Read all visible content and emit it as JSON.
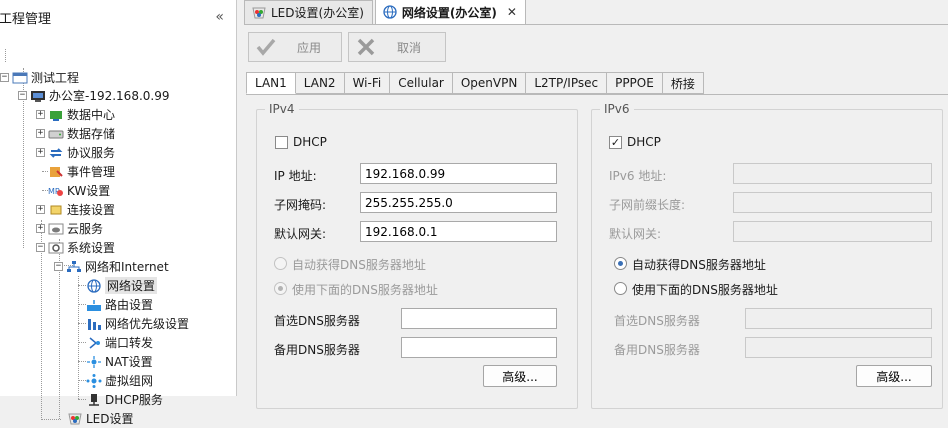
{
  "sidebar": {
    "title": "工程管理",
    "collapse_glyph": "«",
    "tree": [
      {
        "label": "测试工程",
        "expander": "−",
        "icon": "project-icon"
      },
      {
        "label": "办公室-192.168.0.99",
        "expander": "−",
        "icon": "device-icon"
      },
      {
        "label": "数据中心",
        "expander": "+",
        "icon": "data-center-icon"
      },
      {
        "label": "数据存储",
        "expander": "+",
        "icon": "storage-icon"
      },
      {
        "label": "协议服务",
        "expander": "+",
        "icon": "protocol-icon"
      },
      {
        "label": "事件管理",
        "expander": "",
        "icon": "event-icon"
      },
      {
        "label": "KW设置",
        "expander": "",
        "icon": "kw-icon"
      },
      {
        "label": "连接设置",
        "expander": "+",
        "icon": "connection-icon"
      },
      {
        "label": "云服务",
        "expander": "+",
        "icon": "cloud-icon"
      },
      {
        "label": "系统设置",
        "expander": "−",
        "icon": "system-icon"
      },
      {
        "label": "网络和Internet",
        "expander": "−",
        "icon": "network-tree-icon"
      },
      {
        "label": "网络设置",
        "expander": "",
        "icon": "globe-icon"
      },
      {
        "label": "路由设置",
        "expander": "",
        "icon": "router-icon"
      },
      {
        "label": "网络优先级设置",
        "expander": "",
        "icon": "priority-icon"
      },
      {
        "label": "端口转发",
        "expander": "",
        "icon": "port-forward-icon"
      },
      {
        "label": "NAT设置",
        "expander": "",
        "icon": "nat-icon"
      },
      {
        "label": "虚拟组网",
        "expander": "",
        "icon": "vpn-icon"
      },
      {
        "label": "DHCP服务",
        "expander": "",
        "icon": "dhcp-icon"
      },
      {
        "label": "LED设置",
        "expander": "",
        "icon": "led-icon"
      }
    ]
  },
  "doc_tabs": [
    {
      "label": "LED设置(办公室)",
      "icon": "led-icon"
    },
    {
      "label": "网络设置(办公室)",
      "icon": "globe-icon",
      "close": "✕"
    }
  ],
  "toolbar": {
    "apply_label": "应用",
    "cancel_label": "取消"
  },
  "sub_tabs": [
    "LAN1",
    "LAN2",
    "Wi-Fi",
    "Cellular",
    "OpenVPN",
    "L2TP/IPsec",
    "PPPOE",
    "桥接"
  ],
  "ipv4": {
    "legend": "IPv4",
    "dhcp_label": "DHCP",
    "dhcp_checked": false,
    "ip_label": "IP 地址:",
    "ip_value": "192.168.0.99",
    "mask_label": "子网掩码:",
    "mask_value": "255.255.255.0",
    "gateway_label": "默认网关:",
    "gateway_value": "192.168.0.1",
    "auto_dns_label": "自动获得DNS服务器地址",
    "manual_dns_label": "使用下面的DNS服务器地址",
    "preferred_dns_label": "首选DNS服务器",
    "preferred_dns_value": "",
    "alternate_dns_label": "备用DNS服务器",
    "alternate_dns_value": "",
    "advanced_label": "高级..."
  },
  "ipv6": {
    "legend": "IPv6",
    "dhcp_label": "DHCP",
    "dhcp_checked": true,
    "ip_label": "IPv6 地址:",
    "prefix_label": "子网前缀长度:",
    "gateway_label": "默认网关:",
    "auto_dns_label": "自动获得DNS服务器地址",
    "manual_dns_label": "使用下面的DNS服务器地址",
    "preferred_dns_label": "首选DNS服务器",
    "alternate_dns_label": "备用DNS服务器",
    "advanced_label": "高级..."
  },
  "colors": {
    "accent": "#3a6fb5",
    "disabled_text": "#9a9a9a"
  }
}
